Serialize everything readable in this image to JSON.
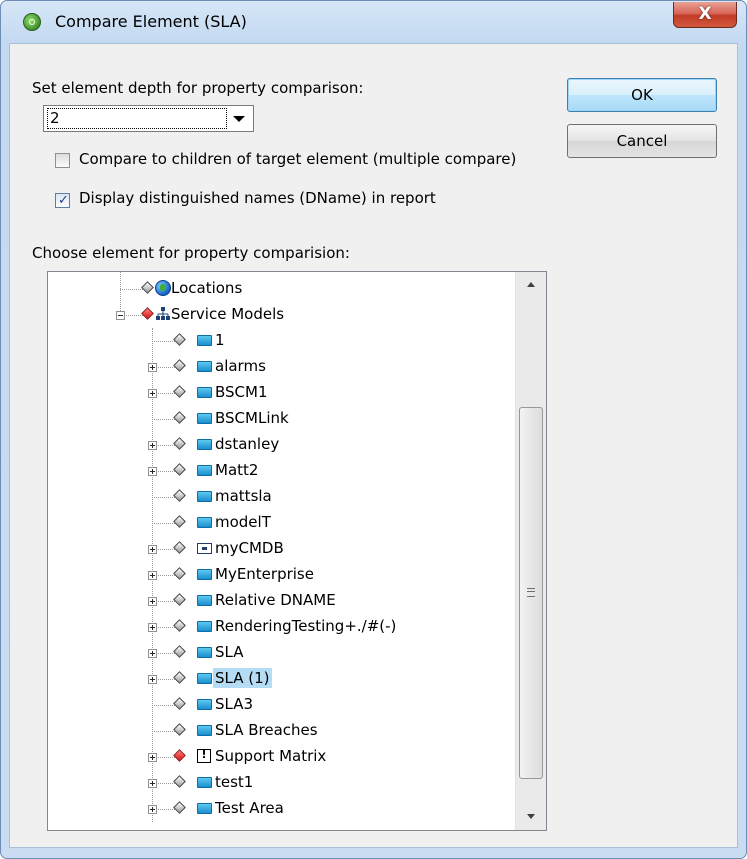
{
  "window": {
    "title": "Compare Element (SLA)",
    "close_label": "X"
  },
  "depth": {
    "label": "Set element depth for property comparison:",
    "selected": "2"
  },
  "options": {
    "multiple_compare": {
      "label": "Compare to children of target element (multiple compare)",
      "checked": false
    },
    "display_dname": {
      "label": "Display distinguished names (DName) in report",
      "checked": true
    }
  },
  "buttons": {
    "ok": "OK",
    "cancel": "Cancel"
  },
  "tree": {
    "label": "Choose element for property comparision:",
    "items": [
      {
        "label": "Locations",
        "icon": "globe-icon",
        "level": 0,
        "expander": "none",
        "diamond": "gray"
      },
      {
        "label": "Service Models",
        "icon": "service-model-icon",
        "level": 0,
        "expander": "minus",
        "diamond": "red"
      },
      {
        "label": "1",
        "icon": "element-icon",
        "level": 1,
        "expander": "none",
        "diamond": "gray"
      },
      {
        "label": "alarms",
        "icon": "element-icon",
        "level": 1,
        "expander": "plus",
        "diamond": "gray"
      },
      {
        "label": "BSCM1",
        "icon": "element-icon",
        "level": 1,
        "expander": "plus",
        "diamond": "gray"
      },
      {
        "label": "BSCMLink",
        "icon": "element-icon",
        "level": 1,
        "expander": "none",
        "diamond": "gray"
      },
      {
        "label": "dstanley",
        "icon": "element-icon",
        "level": 1,
        "expander": "plus",
        "diamond": "gray"
      },
      {
        "label": "Matt2",
        "icon": "element-icon",
        "level": 1,
        "expander": "plus",
        "diamond": "gray"
      },
      {
        "label": "mattsla",
        "icon": "element-icon",
        "level": 1,
        "expander": "none",
        "diamond": "gray"
      },
      {
        "label": "modelT",
        "icon": "element-icon",
        "level": 1,
        "expander": "none",
        "diamond": "gray"
      },
      {
        "label": "myCMDB",
        "icon": "cmdb-icon",
        "level": 1,
        "expander": "plus",
        "diamond": "gray"
      },
      {
        "label": "MyEnterprise",
        "icon": "element-icon",
        "level": 1,
        "expander": "plus",
        "diamond": "gray"
      },
      {
        "label": "Relative DNAME",
        "icon": "element-icon",
        "level": 1,
        "expander": "plus",
        "diamond": "gray"
      },
      {
        "label": "RenderingTesting+./#(-)",
        "icon": "element-icon",
        "level": 1,
        "expander": "plus",
        "diamond": "gray"
      },
      {
        "label": "SLA",
        "icon": "element-icon",
        "level": 1,
        "expander": "plus",
        "diamond": "gray"
      },
      {
        "label": "SLA (1)",
        "icon": "element-icon",
        "level": 1,
        "expander": "plus",
        "diamond": "gray",
        "selected": true
      },
      {
        "label": "SLA3",
        "icon": "element-icon",
        "level": 1,
        "expander": "none",
        "diamond": "gray"
      },
      {
        "label": "SLA Breaches",
        "icon": "element-icon",
        "level": 1,
        "expander": "none",
        "diamond": "gray"
      },
      {
        "label": "Support Matrix",
        "icon": "alert-icon",
        "level": 1,
        "expander": "plus",
        "diamond": "red"
      },
      {
        "label": "test1",
        "icon": "element-icon",
        "level": 1,
        "expander": "plus",
        "diamond": "gray"
      },
      {
        "label": "Test Area",
        "icon": "element-icon",
        "level": 1,
        "expander": "plus",
        "diamond": "gray"
      }
    ]
  }
}
